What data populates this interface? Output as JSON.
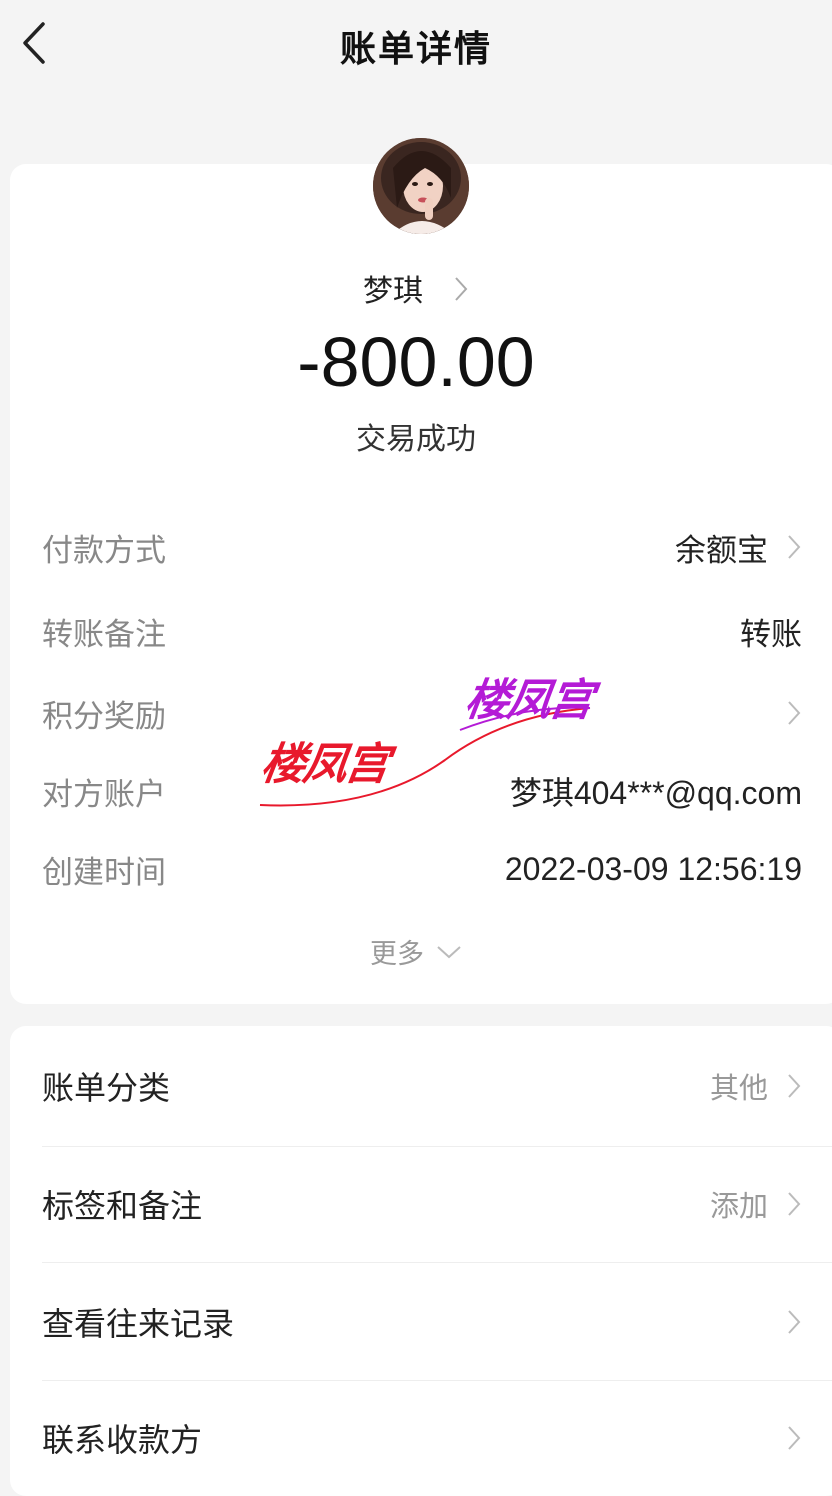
{
  "nav": {
    "title": "账单详情"
  },
  "summary": {
    "payee_name": "梦琪",
    "amount": "-800.00",
    "status": "交易成功"
  },
  "details": [
    {
      "label": "付款方式",
      "value": "余额宝",
      "chevron": true
    },
    {
      "label": "转账备注",
      "value": "转账",
      "chevron": false
    },
    {
      "label": "积分奖励",
      "value": "",
      "chevron": true
    },
    {
      "label": "对方账户",
      "value": "梦琪404***@qq.com",
      "chevron": false
    },
    {
      "label": "创建时间",
      "value": "2022-03-09 12:56:19",
      "chevron": false
    }
  ],
  "more_label": "更多",
  "menu": [
    {
      "label": "账单分类",
      "hint": "其他"
    },
    {
      "label": "标签和备注",
      "hint": "添加"
    },
    {
      "label": "查看往来记录",
      "hint": ""
    },
    {
      "label": "联系收款方",
      "hint": ""
    }
  ],
  "watermark": {
    "text_left": "楼凤宫",
    "text_right": "楼凤宫"
  },
  "colors": {
    "watermark_red": "#e8192c",
    "watermark_purple": "#b41bd6"
  }
}
